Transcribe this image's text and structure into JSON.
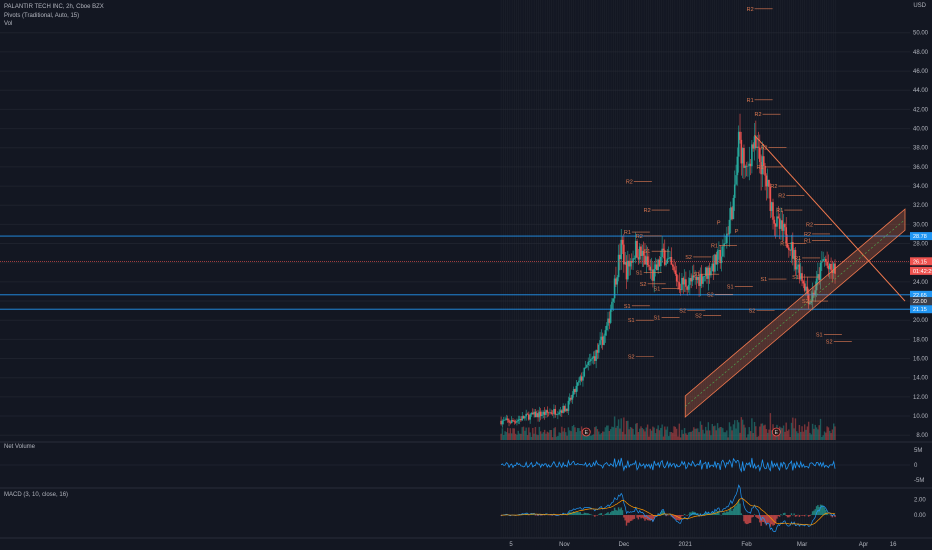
{
  "header": {
    "symbol_line": "PALANTIR TECH INC, 2h, Cboe BZX",
    "pivots_line": "Pivots (Traditional, Auto, 15)",
    "vol_line": "Vol",
    "currency": "USD"
  },
  "panes": {
    "net_volume_label": "Net Volume",
    "macd_label": "MACD (3, 10, close, 16)"
  },
  "colors": {
    "background": "#131722",
    "up": "#26a69a",
    "down": "#ef5350",
    "pivot": "#e07a52",
    "hline": "#2196f3",
    "channel": "#f0784e",
    "net_volume": "#2196f3",
    "macd_line": "#2196f3",
    "signal_line": "#ff9800"
  },
  "chart_data": [
    {
      "type": "candlestick",
      "pane": "price",
      "y_axis_ticks": [
        8,
        10,
        12,
        14,
        16,
        18,
        20,
        22,
        24,
        26,
        28,
        30,
        32,
        34,
        36,
        38,
        40,
        42,
        44,
        46,
        48,
        50
      ],
      "y_tick_labels": [
        "8.00",
        "10.00",
        "12.00",
        "14.00",
        "16.00",
        "18.00",
        "20.00",
        "22.00",
        "24.00",
        "26.00",
        "28.00",
        "30.00",
        "32.00",
        "34.00",
        "36.00",
        "38.00",
        "40.00",
        "42.00",
        "44.00",
        "46.00",
        "48.00",
        "50.00"
      ],
      "ylim": [
        7.5,
        53
      ],
      "x_tick_labels": [
        "5",
        "Nov",
        "Dec",
        "2021",
        "Feb",
        "Mar",
        "Apr",
        "16"
      ],
      "x_range": [
        "2020-10-05",
        "2021-04-22"
      ],
      "x_ticks": [
        "2020-10-05",
        "2020-11-01",
        "2020-12-01",
        "2021-01-01",
        "2021-02-01",
        "2021-03-01",
        "2021-04-01",
        "2021-04-16"
      ],
      "close_path": [
        [
          "2020-09-30",
          9.5
        ],
        [
          "2020-10-05",
          9.4
        ],
        [
          "2020-10-14",
          10.0
        ],
        [
          "2020-10-23",
          10.3
        ],
        [
          "2020-11-02",
          10.8
        ],
        [
          "2020-11-06",
          12.5
        ],
        [
          "2020-11-12",
          15.0
        ],
        [
          "2020-11-18",
          16.8
        ],
        [
          "2020-11-23",
          19.5
        ],
        [
          "2020-11-26",
          23.5
        ],
        [
          "2020-11-30",
          28.0
        ],
        [
          "2020-12-02",
          25.0
        ],
        [
          "2020-12-07",
          27.5
        ],
        [
          "2020-12-11",
          26.5
        ],
        [
          "2020-12-16",
          24.5
        ],
        [
          "2020-12-21",
          27.0
        ],
        [
          "2020-12-29",
          23.8
        ],
        [
          "2021-01-05",
          24.0
        ],
        [
          "2021-01-12",
          25.0
        ],
        [
          "2021-01-20",
          27.0
        ],
        [
          "2021-01-26",
          33.0
        ],
        [
          "2021-01-28",
          39.0
        ],
        [
          "2021-02-01",
          35.0
        ],
        [
          "2021-02-04",
          38.5
        ],
        [
          "2021-02-09",
          36.0
        ],
        [
          "2021-02-16",
          30.0
        ],
        [
          "2021-02-22",
          28.5
        ],
        [
          "2021-02-26",
          26.0
        ],
        [
          "2021-03-02",
          24.0
        ],
        [
          "2021-03-05",
          22.0
        ],
        [
          "2021-03-08",
          23.5
        ],
        [
          "2021-03-12",
          26.5
        ],
        [
          "2021-03-15",
          25.0
        ],
        [
          "2021-03-18",
          25.3
        ]
      ],
      "last_price": 25.15,
      "current_price_line": 26.15,
      "horizontal_lines": [
        28.78,
        22.65,
        21.15
      ],
      "price_labels": [
        {
          "value": 28.78,
          "text": "28.78"
        },
        {
          "value": 26.15,
          "text": "26.15"
        },
        {
          "value": 25.15,
          "text": "01:42:29"
        },
        {
          "value": 22.65,
          "text": "22.65"
        },
        {
          "value": 22.0,
          "text": "22.00"
        },
        {
          "value": 21.15,
          "text": "21.15"
        }
      ],
      "pivot_levels": [
        {
          "label": "R2",
          "date": "2021-02-01",
          "value": 52.5
        },
        {
          "label": "R2",
          "date": "2021-02-05",
          "value": 41.5
        },
        {
          "label": "R1",
          "date": "2021-02-01",
          "value": 43.0
        },
        {
          "label": "R2",
          "date": "2021-02-08",
          "value": 38.0
        },
        {
          "label": "R1",
          "date": "2021-02-06",
          "value": 36.0
        },
        {
          "label": "R2",
          "date": "2020-12-02",
          "value": 34.5
        },
        {
          "label": "R2",
          "date": "2021-02-13",
          "value": 34.0
        },
        {
          "label": "R2",
          "date": "2021-02-17",
          "value": 33.0
        },
        {
          "label": "R1",
          "date": "2021-02-16",
          "value": 31.5
        },
        {
          "label": "R2",
          "date": "2020-12-11",
          "value": 31.5
        },
        {
          "label": "R2",
          "date": "2021-03-03",
          "value": 30.0
        },
        {
          "label": "R2",
          "date": "2021-03-02",
          "value": 29.0
        },
        {
          "label": "R1",
          "date": "2021-03-02",
          "value": 28.3
        },
        {
          "label": "R1",
          "date": "2021-02-18",
          "value": 28.0
        },
        {
          "label": "R1",
          "date": "2021-01-14",
          "value": 27.8
        },
        {
          "label": "R1",
          "date": "2020-12-01",
          "value": 29.2
        },
        {
          "label": "R2",
          "date": "2020-12-07",
          "value": 28.8
        },
        {
          "label": "R1",
          "date": "2021-02-25",
          "value": 26.5
        },
        {
          "label": "S1",
          "date": "2020-12-11",
          "value": 27.2
        },
        {
          "label": "S2",
          "date": "2021-01-01",
          "value": 26.6
        },
        {
          "label": "S1",
          "date": "2021-02-24",
          "value": 24.5
        },
        {
          "label": "S1",
          "date": "2020-12-07",
          "value": 25.0
        },
        {
          "label": "S1",
          "date": "2021-01-05",
          "value": 24.8
        },
        {
          "label": "S1",
          "date": "2021-02-08",
          "value": 24.3
        },
        {
          "label": "S2",
          "date": "2020-12-09",
          "value": 23.8
        },
        {
          "label": "S1",
          "date": "2020-12-16",
          "value": 23.3
        },
        {
          "label": "S1",
          "date": "2021-01-22",
          "value": 23.5
        },
        {
          "label": "S2",
          "date": "2021-01-12",
          "value": 22.7
        },
        {
          "label": "S2",
          "date": "2021-03-01",
          "value": 22.0
        },
        {
          "label": "S1",
          "date": "2020-12-01",
          "value": 21.5
        },
        {
          "label": "S2",
          "date": "2020-12-29",
          "value": 21.0
        },
        {
          "label": "S2",
          "date": "2021-02-02",
          "value": 21.0
        },
        {
          "label": "S2",
          "date": "2021-01-06",
          "value": 20.5
        },
        {
          "label": "S1",
          "date": "2020-12-16",
          "value": 20.3
        },
        {
          "label": "S1",
          "date": "2020-12-03",
          "value": 20.0
        },
        {
          "label": "S1",
          "date": "2021-03-08",
          "value": 18.5
        },
        {
          "label": "S2",
          "date": "2021-03-13",
          "value": 17.8
        },
        {
          "label": "S2",
          "date": "2020-12-03",
          "value": 16.2
        }
      ],
      "pivot_markers": [
        {
          "label": "P",
          "date": "2021-01-17",
          "value": 30.2
        },
        {
          "label": "P",
          "date": "2021-01-26",
          "value": 29.3
        }
      ],
      "trend_lines": [
        {
          "kind": "resistance",
          "from": [
            "2021-02-05",
            39.3
          ],
          "to": [
            "2021-04-22",
            22.0
          ]
        },
        {
          "kind": "rising-channel",
          "from": [
            "2021-01-01",
            11.0
          ],
          "to": [
            "2021-04-22",
            30.5
          ],
          "width": 2.2
        }
      ],
      "earnings_markers": [
        {
          "date": "2020-11-12",
          "label": "E"
        },
        {
          "date": "2021-02-16",
          "label": "E"
        }
      ]
    },
    {
      "type": "line",
      "pane": "net_volume",
      "name": "Net Volume",
      "y_tick_labels": [
        "5M",
        "0",
        "-5M"
      ],
      "ylim": [
        -7,
        7
      ],
      "zero": 0
    },
    {
      "type": "line",
      "pane": "macd",
      "name": "MACD (3, 10, close, 16)",
      "y_tick_labels": [
        "2.00",
        "0.00"
      ],
      "ylim": [
        -2.6,
        3.0
      ]
    }
  ]
}
